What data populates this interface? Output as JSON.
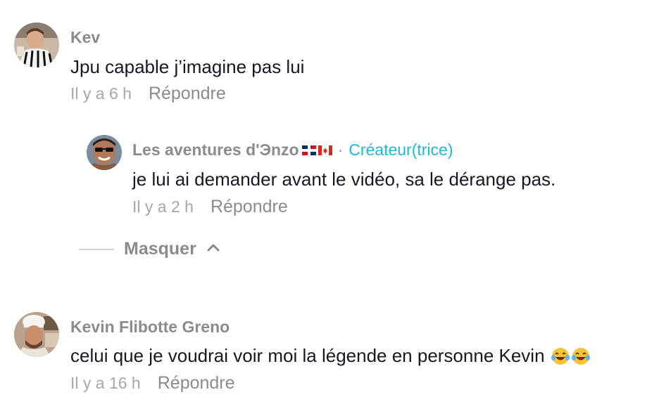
{
  "comments": [
    {
      "username": "Kev",
      "text": "Jpu capable j’imagine pas lui",
      "time": "Il y a 6 h",
      "reply_label": "Répondre",
      "avatar_icon": "user-avatar-striped-shirt"
    },
    {
      "username": "Les aventures d'Эnzo",
      "flags": [
        "flag-dominican-republic-icon",
        "flag-canada-icon"
      ],
      "separator": "·",
      "badge": "Créateur(trice)",
      "text": "je lui ai demander avant le vidéo, sa le dérange pas.",
      "time": "Il y a 2 h",
      "reply_label": "Répondre",
      "avatar_icon": "user-avatar-sunglasses"
    },
    {
      "username": "Kevin Flibotte Greno",
      "text": "celui que je voudrai voir moi la légende en personne Kevin",
      "emoji": [
        "face-with-tears-of-joy-icon",
        "face-with-tears-of-joy-icon"
      ],
      "time": "Il y a 16 h",
      "reply_label": "Répondre",
      "avatar_icon": "user-avatar-chef-hat"
    }
  ],
  "hide_replies": {
    "label": "Masquer",
    "icon": "chevron-up-icon"
  },
  "colors": {
    "username": "#8a8b91",
    "text": "#161823",
    "meta": "#a6a7ab",
    "creator_badge": "#20b8d8"
  }
}
